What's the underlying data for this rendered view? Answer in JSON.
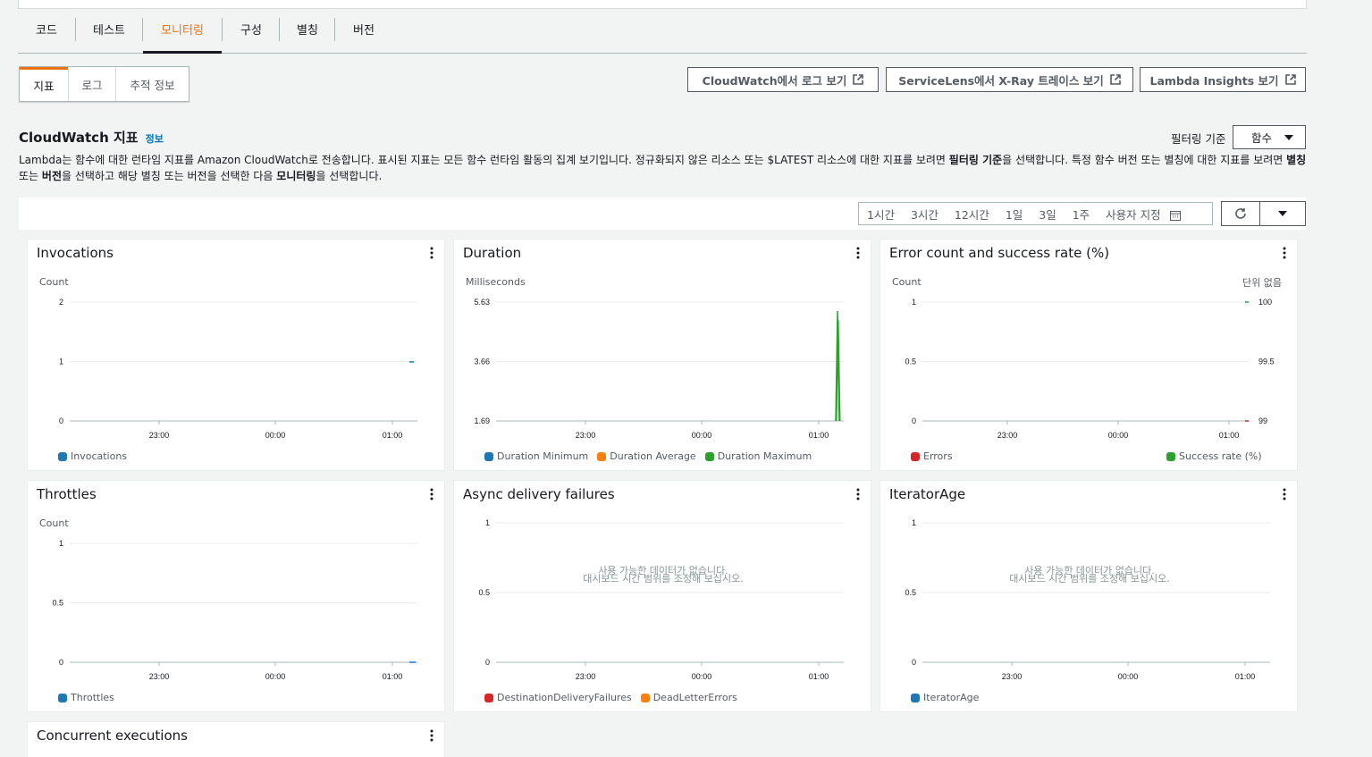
{
  "tabs": [
    "코드",
    "테스트",
    "모니터링",
    "구성",
    "별칭",
    "버전"
  ],
  "subtabs": [
    "지표",
    "로그",
    "추적 정보"
  ],
  "buttons": {
    "cloudwatch_logs": "CloudWatch에서 로그 보기",
    "xray": "ServiceLens에서 X-Ray 트레이스 보기",
    "insights": "Lambda Insights 보기"
  },
  "section": {
    "title": "CloudWatch 지표",
    "info": "정보",
    "filter_label": "필터링 기준",
    "filter_value": "함수",
    "desc_1": "Lambda는 함수에 대한 런타임 지표를 Amazon CloudWatch로 전송합니다. 표시된 지표는 모든 함수 런타임 활동의 집계 보기입니다. 정규화되지 않은 리소스 또는 $LATEST 리소스에 대한 지표를 보려면 ",
    "desc_b1": "필터링 기준",
    "desc_2": "을 선택합니다. 특정 함수 버전 또는 별칭에 대한 지표를 보려면 ",
    "desc_b2": "별칭",
    "desc_3": " 또는 ",
    "desc_b3": "버전",
    "desc_4": "을 선택하고 해당 별칭 또는 버전을 선택한 다음 ",
    "desc_b4": "모니터링",
    "desc_5": "을 선택합니다."
  },
  "timerange": [
    "1시간",
    "3시간",
    "12시간",
    "1일",
    "3일",
    "1주",
    "사용자 지정"
  ],
  "colors": {
    "blue": "#1f77b4",
    "orange": "#ff7f0e",
    "green": "#2ca02c",
    "red": "#d62728",
    "accent": "#ec7211"
  },
  "panels": [
    {
      "title": "Invocations",
      "ylabel": "Count",
      "yticks": [
        "2",
        "1",
        "0"
      ],
      "xticks": [
        "23:00",
        "00:00",
        "01:00"
      ],
      "legend": [
        "Invocations"
      ]
    },
    {
      "title": "Duration",
      "ylabel": "Milliseconds",
      "yticks": [
        "5.63",
        "3.66",
        "1.69"
      ],
      "xticks": [
        "23:00",
        "00:00",
        "01:00"
      ],
      "legend": [
        "Duration Minimum",
        "Duration Average",
        "Duration Maximum"
      ]
    },
    {
      "title": "Error count and success rate (%)",
      "ylabel": "Count",
      "ylabel_right": "단위 없음",
      "yticks": [
        "1",
        "0.5",
        "0"
      ],
      "yticks_right": [
        "100",
        "99.5",
        "99"
      ],
      "xticks": [
        "23:00",
        "00:00",
        "01:00"
      ],
      "legend": [
        "Errors",
        "Success rate (%)"
      ]
    },
    {
      "title": "Throttles",
      "ylabel": "Count",
      "yticks": [
        "1",
        "0.5",
        "0"
      ],
      "xticks": [
        "23:00",
        "00:00",
        "01:00"
      ],
      "legend": [
        "Throttles"
      ]
    },
    {
      "title": "Async delivery failures",
      "yticks": [
        "1",
        "0.5",
        "0"
      ],
      "xticks": [
        "23:00",
        "00:00",
        "01:00"
      ],
      "legend": [
        "DestinationDeliveryFailures",
        "DeadLetterErrors"
      ],
      "nodata_1": "사용 가능한 데이터가 없습니다.",
      "nodata_2": "대시보드 시간 범위를 조정해 보십시오."
    },
    {
      "title": "IteratorAge",
      "yticks": [
        "1",
        "0.5",
        "0"
      ],
      "xticks": [
        "23:00",
        "00:00",
        "01:00"
      ],
      "legend": [
        "IteratorAge"
      ],
      "nodata_1": "사용 가능한 데이터가 없습니다.",
      "nodata_2": "대시보드 시간 범위를 조정해 보십시오."
    },
    {
      "title": "Concurrent executions"
    }
  ]
}
